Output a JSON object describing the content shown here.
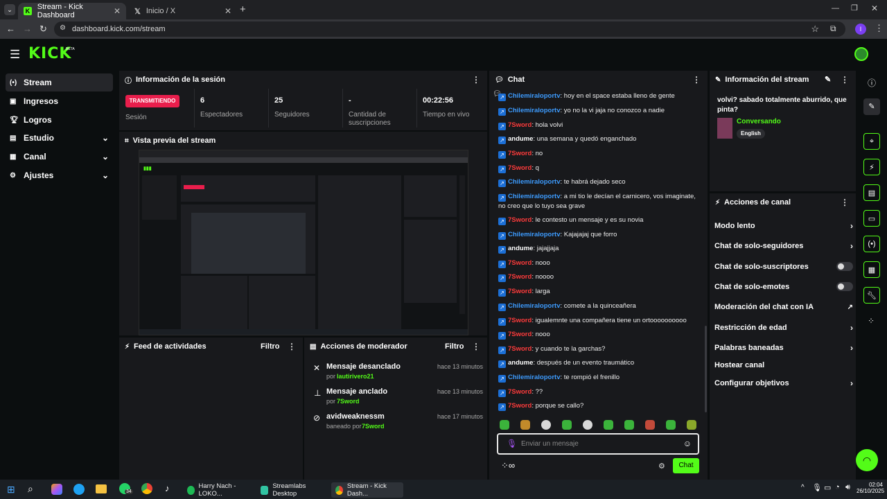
{
  "browser": {
    "tabs": [
      {
        "title": "Stream - Kick Dashboard"
      },
      {
        "title": "Inicio / X"
      }
    ],
    "url": "dashboard.kick.com/stream"
  },
  "kick": {
    "logo": "KICK",
    "beta": "BETA"
  },
  "sidebar": {
    "items": [
      {
        "label": "Stream",
        "icon": "stream-icon"
      },
      {
        "label": "Ingresos",
        "icon": "dollar-icon"
      },
      {
        "label": "Logros",
        "icon": "trophy-icon"
      },
      {
        "label": "Estudio",
        "icon": "studio-icon"
      },
      {
        "label": "Canal",
        "icon": "channel-icon"
      },
      {
        "label": "Ajustes",
        "icon": "gear-icon"
      }
    ]
  },
  "session": {
    "title": "Información de la sesión",
    "status": "TRANSMITIENDO",
    "session_label": "Sesión",
    "stats": [
      {
        "value": "6",
        "label": "Espectadores"
      },
      {
        "value": "25",
        "label": "Seguidores"
      },
      {
        "value": "-",
        "label": "Cantidad de suscripciones"
      },
      {
        "value": "00:22:56",
        "label": "Tiempo en vivo"
      }
    ]
  },
  "preview": {
    "title": "Vista previa del stream"
  },
  "feed": {
    "title": "Feed de actividades",
    "filter": "Filtro"
  },
  "modactions": {
    "title": "Acciones de moderador",
    "filter": "Filtro",
    "items": [
      {
        "action": "Mensaje desanclado",
        "by_prefix": "por",
        "by": "lautirivero21",
        "time": "hace 13 minutos"
      },
      {
        "action": "Mensaje anclado",
        "by_prefix": "por",
        "by": "7Sword",
        "time": "hace 13 minutos"
      },
      {
        "action": "avidweaknessm",
        "by_prefix": "baneado por",
        "by": "7Sword",
        "time": "hace 17 minutos"
      }
    ]
  },
  "chat": {
    "title": "Chat",
    "messages": [
      {
        "user": "Chilemiraloportv",
        "color": "blue",
        "text": "hoy en el space estaba lleno de gente"
      },
      {
        "user": "Chilemiraloportv",
        "color": "blue",
        "text": "yo no la vi jaja no conozco a nadie"
      },
      {
        "user": "7Sword",
        "color": "red",
        "text": "hola volvi"
      },
      {
        "user": "andume",
        "color": "white",
        "text": "una semana y quedó enganchado"
      },
      {
        "user": "7Sword",
        "color": "red",
        "text": "no"
      },
      {
        "user": "7Sword",
        "color": "red",
        "text": "q"
      },
      {
        "user": "Chilemiraloportv",
        "color": "blue",
        "text": "te habrá dejado seco"
      },
      {
        "user": "Chilemiraloportv",
        "color": "blue",
        "text": "a mi tio le decían el carnicero, vos imaginate, no creo que lo tuyo sea grave"
      },
      {
        "user": "7Sword",
        "color": "red",
        "text": "le contesto un mensaje y es su novia"
      },
      {
        "user": "Chilemiraloportv",
        "color": "blue",
        "text": "Kajajajaj que forro"
      },
      {
        "user": "andume",
        "color": "white",
        "text": "jajajjaja"
      },
      {
        "user": "7Sword",
        "color": "red",
        "text": "nooo"
      },
      {
        "user": "7Sword",
        "color": "red",
        "text": "noooo"
      },
      {
        "user": "7Sword",
        "color": "red",
        "text": "larga"
      },
      {
        "user": "Chilemiraloportv",
        "color": "blue",
        "text": "comete a la quinceañera"
      },
      {
        "user": "7Sword",
        "color": "red",
        "text": "igualemnte una compañera tiene un ortoooooooooo"
      },
      {
        "user": "7Sword",
        "color": "red",
        "text": "nooo"
      },
      {
        "user": "7Sword",
        "color": "red",
        "text": "y cuando te la garchas?"
      },
      {
        "user": "andume",
        "color": "white",
        "text": "después de un evento traumático"
      },
      {
        "user": "Chilemiraloportv",
        "color": "blue",
        "text": "te rompió el frenillo"
      },
      {
        "user": "7Sword",
        "color": "red",
        "text": "??"
      },
      {
        "user": "7Sword",
        "color": "red",
        "text": "porque se callo?"
      }
    ],
    "placeholder": "Enviar un mensaje",
    "send": "Chat"
  },
  "streaminfo": {
    "title": "Información del stream",
    "stream_title": "volvi? sabado totalmente aburrido, que pinta?",
    "category": "Conversando",
    "language": "English"
  },
  "channel": {
    "title": "Acciones de canal",
    "items": [
      {
        "label": "Modo lento",
        "control": "chevron"
      },
      {
        "label": "Chat de solo-seguidores",
        "control": "chevron"
      },
      {
        "label": "Chat de solo-suscriptores",
        "control": "toggle"
      },
      {
        "label": "Chat de solo-emotes",
        "control": "toggle"
      },
      {
        "label": "Moderación del chat con IA",
        "control": "external"
      },
      {
        "label": "Restricción de edad",
        "control": "chevron"
      },
      {
        "label": "Palabras baneadas",
        "control": "chevron"
      },
      {
        "label": "Hostear canal",
        "control": "none"
      },
      {
        "label": "Configurar objetivos",
        "control": "chevron"
      }
    ]
  },
  "taskbar": {
    "apps": [
      {
        "label": "Harry Nach - LOKO..."
      },
      {
        "label": "Streamlabs Desktop"
      },
      {
        "label": "Stream - Kick Dash..."
      }
    ],
    "whatsapp_count": "34",
    "time": "02:04",
    "date": "26/10/2025"
  },
  "colors": {
    "accent": "#53fc18",
    "live": "#e91e4c",
    "panel": "#18191c",
    "bg": "#0b0e0f"
  }
}
